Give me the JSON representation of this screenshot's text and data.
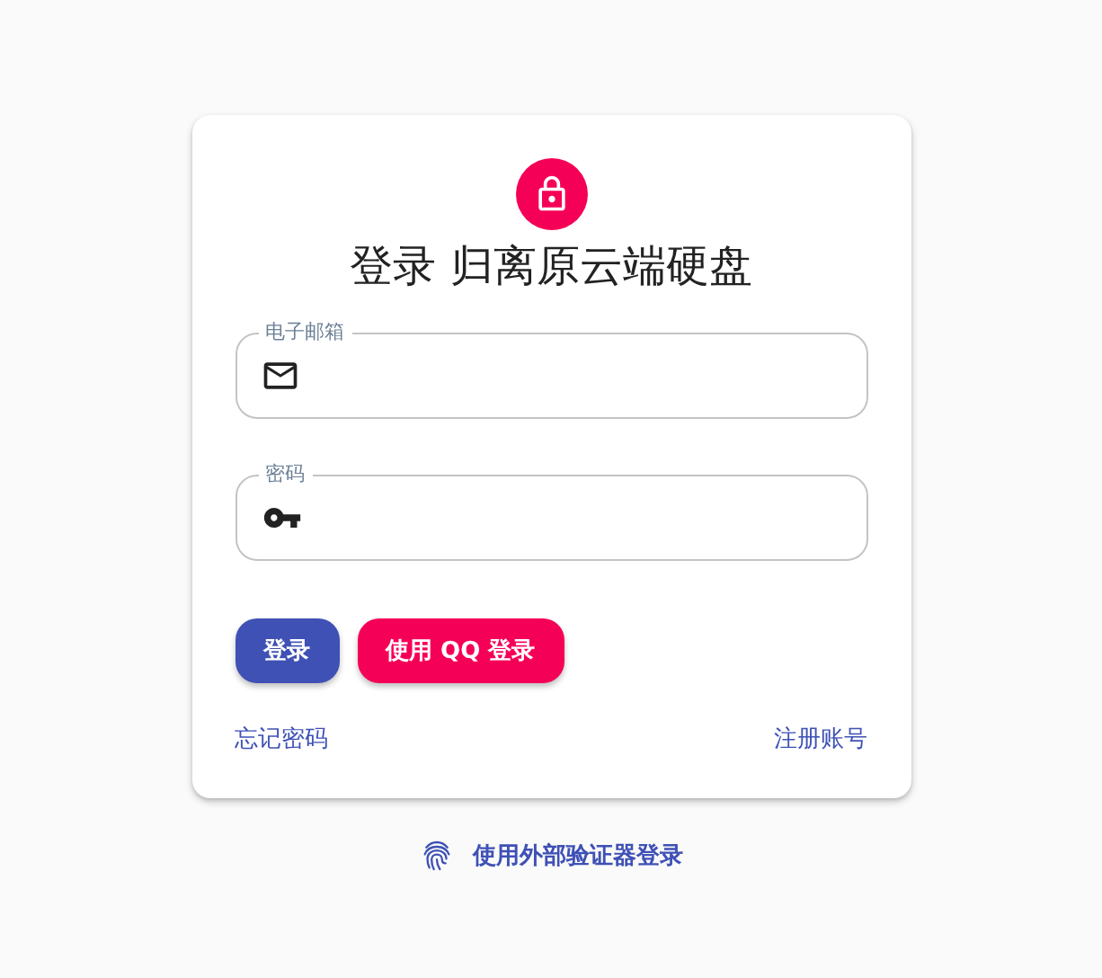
{
  "title": "登录 归离原云端硬盘",
  "fields": [
    {
      "kind": "email",
      "label": "电子邮箱"
    },
    {
      "kind": "password",
      "label": "密码"
    }
  ],
  "buttons": [
    {
      "kind": "primary",
      "label": "登录"
    },
    {
      "kind": "qq",
      "label": "使用 QQ 登录"
    }
  ],
  "links": {
    "forgot": "忘记密码",
    "register": "注册账号"
  },
  "external_login": "使用外部验证器登录"
}
